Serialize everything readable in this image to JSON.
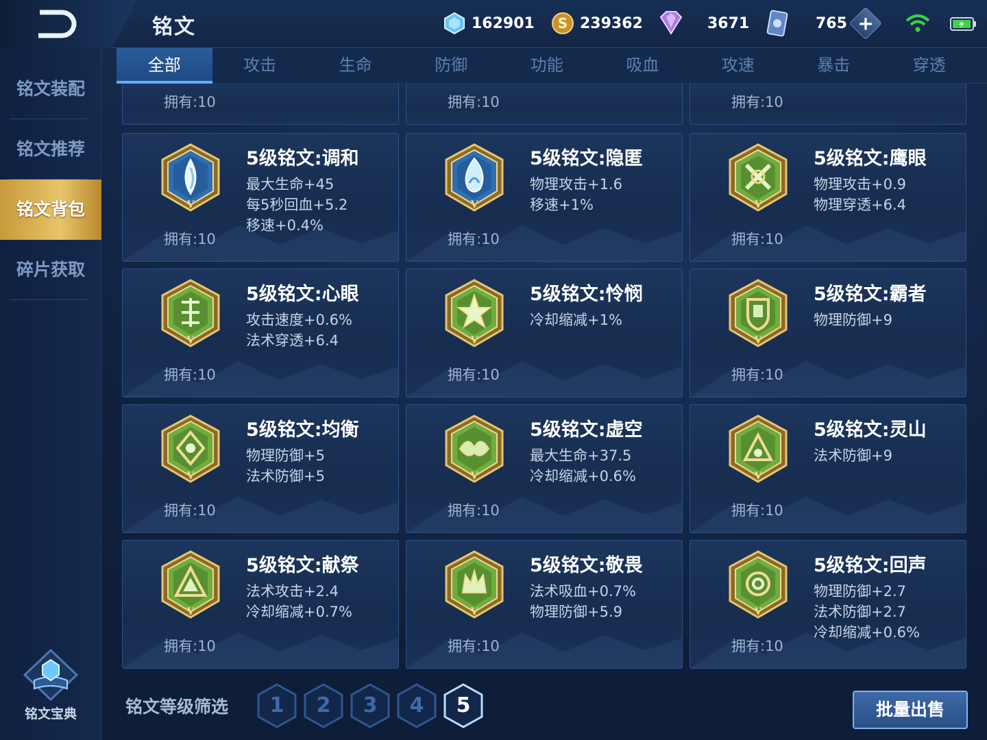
{
  "header": {
    "title": "铭文",
    "resources": [
      {
        "name": "diamond",
        "icon": "blue-crystal-icon",
        "value": "162901"
      },
      {
        "name": "gold",
        "icon": "gold-coin-icon",
        "value": "239362"
      },
      {
        "name": "gem",
        "icon": "purple-gem-icon",
        "value": "3671"
      },
      {
        "name": "coupon",
        "icon": "coupon-card-icon",
        "value": "765"
      }
    ]
  },
  "tabs": [
    "全部",
    "攻击",
    "生命",
    "防御",
    "功能",
    "吸血",
    "攻速",
    "暴击",
    "穿透"
  ],
  "active_tab": 0,
  "sidebar": {
    "items": [
      "铭文装配",
      "铭文推荐",
      "铭文背包",
      "碎片获取"
    ],
    "active": 2,
    "codex_label": "铭文宝典"
  },
  "partial_row": {
    "owned": "拥有:10"
  },
  "cards": [
    {
      "name": "5级铭文:调和",
      "stats": [
        "最大生命+45",
        "每5秒回血+5.2",
        "移速+0.4%"
      ],
      "owned": "拥有:10",
      "color": "blue",
      "glyph": "drop"
    },
    {
      "name": "5级铭文:隐匿",
      "stats": [
        "物理攻击+1.6",
        "移速+1%"
      ],
      "owned": "拥有:10",
      "color": "blue",
      "glyph": "flame"
    },
    {
      "name": "5级铭文:鹰眼",
      "stats": [
        "物理攻击+0.9",
        "物理穿透+6.4"
      ],
      "owned": "拥有:10",
      "color": "green",
      "glyph": "cross"
    },
    {
      "name": "5级铭文:心眼",
      "stats": [
        "攻击速度+0.6%",
        "法术穿透+6.4"
      ],
      "owned": "拥有:10",
      "color": "green",
      "glyph": "grid"
    },
    {
      "name": "5级铭文:怜悯",
      "stats": [
        "冷却缩减+1%"
      ],
      "owned": "拥有:10",
      "color": "green",
      "glyph": "star"
    },
    {
      "name": "5级铭文:霸者",
      "stats": [
        "物理防御+9"
      ],
      "owned": "拥有:10",
      "color": "green",
      "glyph": "shield"
    },
    {
      "name": "5级铭文:均衡",
      "stats": [
        "物理防御+5",
        "法术防御+5"
      ],
      "owned": "拥有:10",
      "color": "green",
      "glyph": "diamond"
    },
    {
      "name": "5级铭文:虚空",
      "stats": [
        "最大生命+37.5",
        "冷却缩减+0.6%"
      ],
      "owned": "拥有:10",
      "color": "green",
      "glyph": "wing"
    },
    {
      "name": "5级铭文:灵山",
      "stats": [
        "法术防御+9"
      ],
      "owned": "拥有:10",
      "color": "green",
      "glyph": "mountain"
    },
    {
      "name": "5级铭文:献祭",
      "stats": [
        "法术攻击+2.4",
        "冷却缩减+0.7%"
      ],
      "owned": "拥有:10",
      "color": "green",
      "glyph": "tri"
    },
    {
      "name": "5级铭文:敬畏",
      "stats": [
        "法术吸血+0.7%",
        "物理防御+5.9"
      ],
      "owned": "拥有:10",
      "color": "green",
      "glyph": "crown"
    },
    {
      "name": "5级铭文:回声",
      "stats": [
        "物理防御+2.7",
        "法术防御+2.7",
        "冷却缩减+0.6%"
      ],
      "owned": "拥有:10",
      "color": "green",
      "glyph": "ring"
    }
  ],
  "filter": {
    "label": "铭文等级筛选",
    "levels": [
      "1",
      "2",
      "3",
      "4",
      "5"
    ],
    "active": 4
  },
  "sell_button": "批量出售",
  "colors": {
    "gold": "#d9b45a",
    "green": "#6aa83c",
    "blue": "#3f7fc4",
    "accent": "#5ab0ff"
  }
}
